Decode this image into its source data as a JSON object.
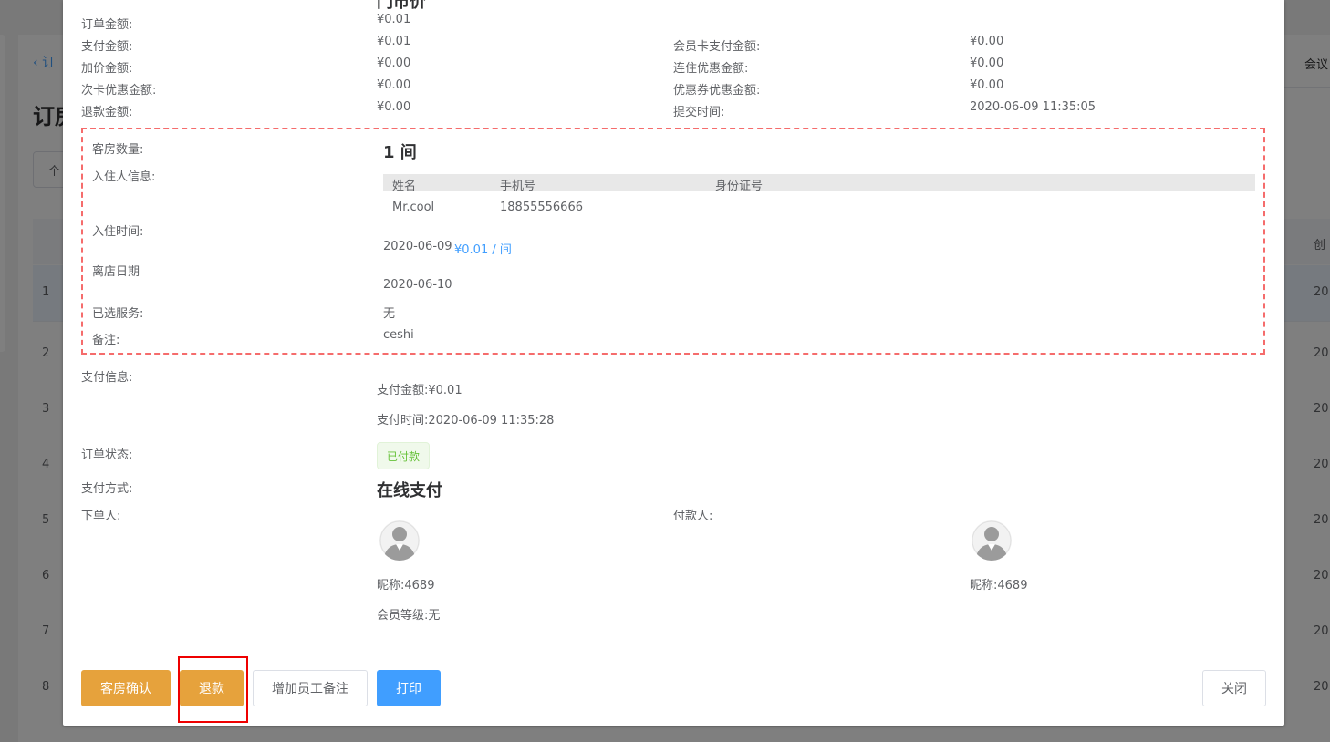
{
  "background": {
    "breadcrumb": "订",
    "title": "订房",
    "tab_left": "个",
    "tab_right": "会议",
    "header_right": "创",
    "rows": [
      {
        "num": "1",
        "year": "20"
      },
      {
        "num": "2",
        "year": "20"
      },
      {
        "num": "3",
        "year": "20"
      },
      {
        "num": "4",
        "year": "20"
      },
      {
        "num": "5",
        "year": "20"
      },
      {
        "num": "6",
        "year": "20"
      },
      {
        "num": "7",
        "year": "20"
      },
      {
        "num": "8",
        "year": "20"
      }
    ]
  },
  "dialog": {
    "cut_title": "门市价",
    "amounts": {
      "order_amount": {
        "label": "订单金额:",
        "value": "¥0.01"
      },
      "pay_amount": {
        "label": "支付金额:",
        "value": "¥0.01"
      },
      "markup_amount": {
        "label": "加价金额:",
        "value": "¥0.00"
      },
      "card_discount": {
        "label": "次卡优惠金额:",
        "value": "¥0.00"
      },
      "refund_amount": {
        "label": "退款金额:",
        "value": "¥0.00"
      },
      "member_card_pay": {
        "label": "会员卡支付金额:",
        "value": "¥0.00"
      },
      "stay_discount": {
        "label": "连住优惠金额:",
        "value": "¥0.00"
      },
      "coupon_discount": {
        "label": "优惠券优惠金额:",
        "value": "¥0.00"
      },
      "submit_time": {
        "label": "提交时间:",
        "value": "2020-06-09 11:35:05"
      }
    },
    "room": {
      "count_label": "客房数量:",
      "count_value": "1 间",
      "guest_label": "入住人信息:",
      "guest_columns": [
        "姓名",
        "手机号",
        "身份证号"
      ],
      "guest_rows": [
        [
          "Mr.cool",
          "18855556666",
          ""
        ]
      ],
      "checkin_label": "入住时间:",
      "checkin_date": "2020-06-09",
      "checkin_price": "¥0.01 / 间",
      "checkout_label": "离店日期",
      "checkout_date": "2020-06-10",
      "services_label": "已选服务:",
      "services_value": "无",
      "remark_label": "备注:",
      "remark_value": "ceshi"
    },
    "payment": {
      "info_label": "支付信息:",
      "pay_amount": "支付金额:¥0.01",
      "pay_time": "支付时间:2020-06-09 11:35:28",
      "status_label": "订单状态:",
      "status_value": "已付款",
      "method_label": "支付方式:",
      "method_value": "在线支付"
    },
    "people": {
      "orderer_label": "下单人:",
      "orderer_nickname": "昵称:4689",
      "orderer_level": "会员等级:无",
      "payer_label": "付款人:",
      "payer_nickname": "昵称:4689"
    },
    "buttons": {
      "confirm_room": "客房确认",
      "refund": "退款",
      "add_staff_note": "增加员工备注",
      "print": "打印",
      "close": "关闭"
    }
  }
}
